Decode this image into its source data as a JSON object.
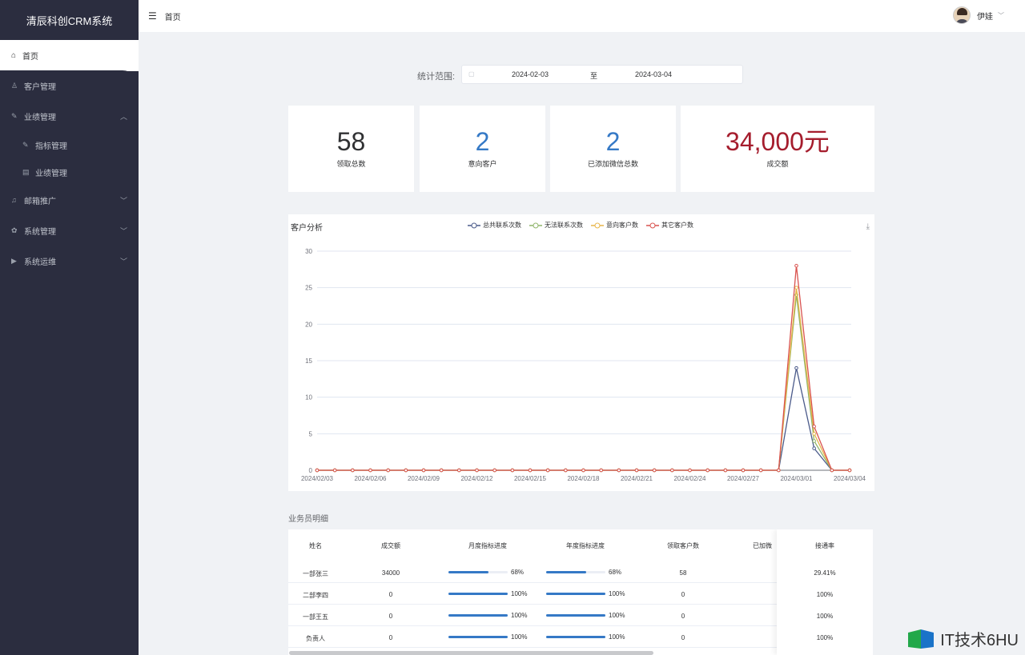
{
  "app": {
    "title": "清辰科创CRM系统"
  },
  "sidebar": {
    "home": "首页",
    "items": [
      {
        "label": "客户管理",
        "icon": "user-icon"
      },
      {
        "label": "业绩管理",
        "icon": "edit-icon"
      },
      {
        "label": "指标管理",
        "icon": "edit-icon"
      },
      {
        "label": "业绩管理",
        "icon": "list-icon"
      },
      {
        "label": "邮箱推广",
        "icon": "bell-icon"
      },
      {
        "label": "系统管理",
        "icon": "gear-icon"
      },
      {
        "label": "系统运维",
        "icon": "tool-icon"
      }
    ]
  },
  "topbar": {
    "breadcrumb": "首页",
    "username": "伊娃"
  },
  "filter": {
    "label": "统计范围:",
    "start": "2024-02-03",
    "sep": "至",
    "end": "2024-03-04"
  },
  "cards": [
    {
      "value": "58",
      "label": "领取总数",
      "color": "#303133"
    },
    {
      "value": "2",
      "label": "意向客户",
      "color": "#3579c6"
    },
    {
      "value": "2",
      "label": "已添加微信总数",
      "color": "#3579c6"
    },
    {
      "value": "34,000元",
      "label": "成交额",
      "color": "#a51d2d"
    }
  ],
  "chart_data": {
    "type": "line",
    "title": "客户分析",
    "x": [
      "2024/02/03",
      "2024/02/04",
      "2024/02/05",
      "2024/02/06",
      "2024/02/07",
      "2024/02/08",
      "2024/02/09",
      "2024/02/10",
      "2024/02/11",
      "2024/02/12",
      "2024/02/13",
      "2024/02/14",
      "2024/02/15",
      "2024/02/16",
      "2024/02/17",
      "2024/02/18",
      "2024/02/19",
      "2024/02/20",
      "2024/02/21",
      "2024/02/22",
      "2024/02/23",
      "2024/02/24",
      "2024/02/25",
      "2024/02/26",
      "2024/02/27",
      "2024/02/28",
      "2024/02/29",
      "2024/03/01",
      "2024/03/02",
      "2024/03/03",
      "2024/03/04"
    ],
    "xticks": [
      "2024/02/03",
      "2024/02/06",
      "2024/02/09",
      "2024/02/12",
      "2024/02/15",
      "2024/02/18",
      "2024/02/21",
      "2024/02/24",
      "2024/02/27",
      "2024/03/01",
      "2024/03/04"
    ],
    "ylim": [
      0,
      30
    ],
    "yticks": [
      0,
      5,
      10,
      15,
      20,
      25,
      30
    ],
    "grid": true,
    "legend": "top-center",
    "series": [
      {
        "name": "总共联系次数",
        "color": "#4a5a8a",
        "values": [
          0,
          0,
          0,
          0,
          0,
          0,
          0,
          0,
          0,
          0,
          0,
          0,
          0,
          0,
          0,
          0,
          0,
          0,
          0,
          0,
          0,
          0,
          0,
          0,
          0,
          0,
          0,
          14,
          3,
          0,
          0
        ]
      },
      {
        "name": "无法联系次数",
        "color": "#8fb56a",
        "values": [
          0,
          0,
          0,
          0,
          0,
          0,
          0,
          0,
          0,
          0,
          0,
          0,
          0,
          0,
          0,
          0,
          0,
          0,
          0,
          0,
          0,
          0,
          0,
          0,
          0,
          0,
          0,
          24,
          4,
          0,
          0
        ]
      },
      {
        "name": "意向客户数",
        "color": "#e8b64a",
        "values": [
          0,
          0,
          0,
          0,
          0,
          0,
          0,
          0,
          0,
          0,
          0,
          0,
          0,
          0,
          0,
          0,
          0,
          0,
          0,
          0,
          0,
          0,
          0,
          0,
          0,
          0,
          0,
          25,
          5,
          0,
          0
        ]
      },
      {
        "name": "其它客户数",
        "color": "#d9534f",
        "values": [
          0,
          0,
          0,
          0,
          0,
          0,
          0,
          0,
          0,
          0,
          0,
          0,
          0,
          0,
          0,
          0,
          0,
          0,
          0,
          0,
          0,
          0,
          0,
          0,
          0,
          0,
          0,
          28,
          6,
          0,
          0
        ]
      }
    ]
  },
  "table": {
    "section_title": "业务员明细",
    "headers": [
      "姓名",
      "成交额",
      "月度指标进度",
      "年度指标进度",
      "领取客户数",
      "已加微",
      "接通率"
    ],
    "rows": [
      {
        "name": "一部张三",
        "amount": "34000",
        "month": 68,
        "month_label": "68%",
        "year": 68,
        "year_label": "68%",
        "claimed": "58",
        "rate": "29.41%"
      },
      {
        "name": "二部李四",
        "amount": "0",
        "month": 100,
        "month_label": "100%",
        "year": 100,
        "year_label": "100%",
        "claimed": "0",
        "rate": "100%"
      },
      {
        "name": "一部王五",
        "amount": "0",
        "month": 100,
        "month_label": "100%",
        "year": 100,
        "year_label": "100%",
        "claimed": "0",
        "rate": "100%"
      },
      {
        "name": "负责人",
        "amount": "0",
        "month": 100,
        "month_label": "100%",
        "year": 100,
        "year_label": "100%",
        "claimed": "0",
        "rate": "100%"
      }
    ]
  },
  "watermark": {
    "text": "IT技术6HU"
  }
}
